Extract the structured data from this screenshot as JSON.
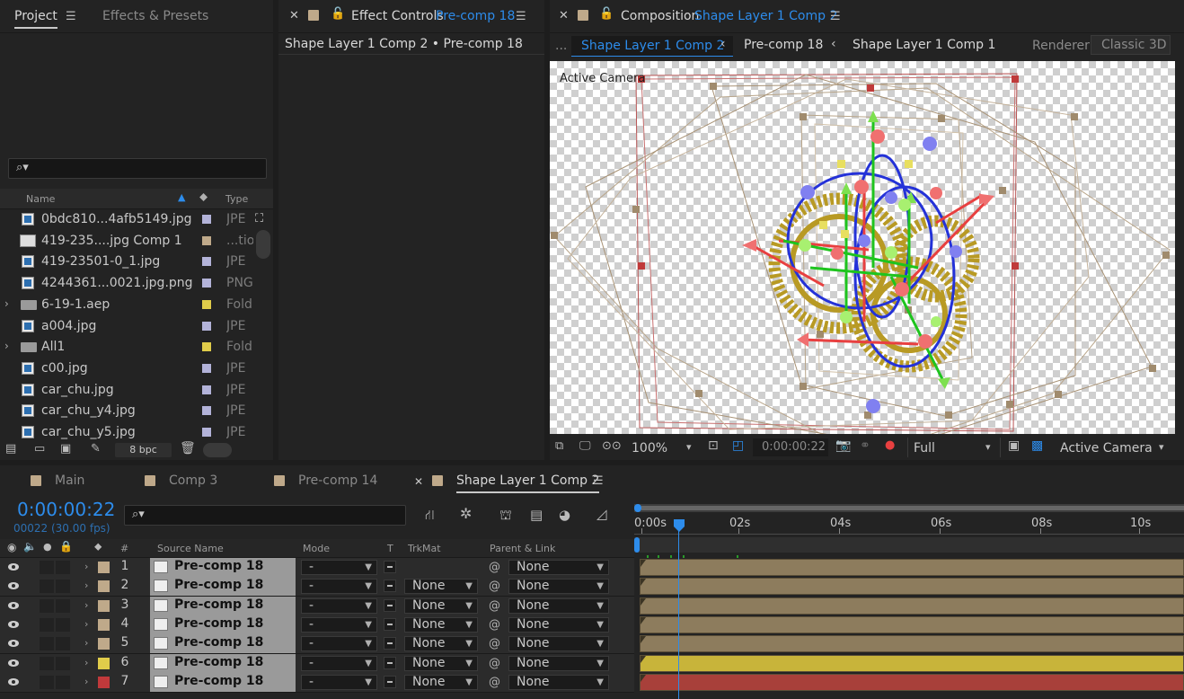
{
  "project_panel": {
    "tabs": [
      "Project",
      "Effects & Presets"
    ],
    "search_placeholder": "",
    "col_name": "Name",
    "col_type": "Type",
    "items": [
      {
        "name": "0bdc810...4afb5149.jpg",
        "type": "JPE",
        "label_color": "#b3b3d9",
        "icon": "image-file-icon",
        "expand": false
      },
      {
        "name": "419-235....jpg Comp 1",
        "type": "...tion",
        "label_color": "#bfa98a",
        "icon": "composition-icon",
        "expand": false
      },
      {
        "name": "419-23501-0_1.jpg",
        "type": "JPE",
        "label_color": "#b3b3d9",
        "icon": "image-file-icon",
        "expand": false
      },
      {
        "name": "4244361...0021.jpg.png",
        "type": "PNG",
        "label_color": "#b3b3d9",
        "icon": "image-file-icon",
        "expand": false
      },
      {
        "name": "6-19-1.aep",
        "type": "Fold",
        "label_color": "#e0cc4a",
        "icon": "folder-icon",
        "expand": true
      },
      {
        "name": "a004.jpg",
        "type": "JPE",
        "label_color": "#b3b3d9",
        "icon": "image-file-icon",
        "expand": false
      },
      {
        "name": "All1",
        "type": "Fold",
        "label_color": "#e0cc4a",
        "icon": "folder-icon",
        "expand": true
      },
      {
        "name": "c00.jpg",
        "type": "JPE",
        "label_color": "#b3b3d9",
        "icon": "image-file-icon",
        "expand": false
      },
      {
        "name": "car_chu.jpg",
        "type": "JPE",
        "label_color": "#b3b3d9",
        "icon": "image-file-icon",
        "expand": false
      },
      {
        "name": "car_chu_y4.jpg",
        "type": "JPE",
        "label_color": "#b3b3d9",
        "icon": "image-file-icon",
        "expand": false
      },
      {
        "name": "car_chu_y5.jpg",
        "type": "JPE",
        "label_color": "#b3b3d9",
        "icon": "image-file-icon",
        "expand": false
      }
    ],
    "bpc": "8 bpc"
  },
  "effect_controls": {
    "tab_label": "Effect Controls",
    "tab_target": "Pre-comp 18",
    "breadcrumb": "Shape Layer 1 Comp 2 • Pre-comp 18"
  },
  "composition": {
    "tab_label": "Composition",
    "tab_target": "Shape Layer 1 Comp 2",
    "nav_more": "...",
    "flow": [
      "Shape Layer 1 Comp 2",
      "Pre-comp 18",
      "Shape Layer 1 Comp 1"
    ],
    "renderer_label": "Renderer:",
    "renderer_value": "Classic 3D",
    "viewport_label": "Active Camera",
    "zoom": "100%",
    "timecode": "0:00:00:22",
    "resolution": "Full",
    "view": "Active Camera"
  },
  "timeline": {
    "tabs": [
      {
        "label": "Main",
        "color": "#bfa98a",
        "active": false
      },
      {
        "label": "Comp 3",
        "color": "#bfa98a",
        "active": false
      },
      {
        "label": "Pre-comp 14",
        "color": "#bfa98a",
        "active": false
      },
      {
        "label": "Shape Layer 1 Comp 2",
        "color": "#bfa98a",
        "active": true
      }
    ],
    "current_time": "0:00:00:22",
    "frame_info": "00022 (30.00 fps)",
    "search_placeholder": "",
    "columns": {
      "num": "#",
      "source": "Source Name",
      "mode": "Mode",
      "t": "T",
      "trkmat": "TrkMat",
      "parent": "Parent & Link"
    },
    "ruler": [
      "0:00s",
      "02s",
      "04s",
      "06s",
      "08s",
      "10s"
    ],
    "layers": [
      {
        "num": "1",
        "name": "Pre-comp 18",
        "mode": "-",
        "trkmat": "",
        "parent": "None",
        "color": "#bfa98a",
        "bar": "#8d7c5d"
      },
      {
        "num": "2",
        "name": "Pre-comp 18",
        "mode": "-",
        "trkmat": "None",
        "parent": "None",
        "color": "#bfa98a",
        "bar": "#8d7c5d"
      },
      {
        "num": "3",
        "name": "Pre-comp 18",
        "mode": "-",
        "trkmat": "None",
        "parent": "None",
        "color": "#bfa98a",
        "bar": "#8d7c5d"
      },
      {
        "num": "4",
        "name": "Pre-comp 18",
        "mode": "-",
        "trkmat": "None",
        "parent": "None",
        "color": "#bfa98a",
        "bar": "#8d7c5d"
      },
      {
        "num": "5",
        "name": "Pre-comp 18",
        "mode": "-",
        "trkmat": "None",
        "parent": "None",
        "color": "#bfa98a",
        "bar": "#8d7c5d"
      },
      {
        "num": "6",
        "name": "Pre-comp 18",
        "mode": "-",
        "trkmat": "None",
        "parent": "None",
        "color": "#e0cc4a",
        "bar": "#c8b43a"
      },
      {
        "num": "7",
        "name": "Pre-comp 18",
        "mode": "-",
        "trkmat": "None",
        "parent": "None",
        "color": "#c0393b",
        "bar": "#a8403a"
      }
    ]
  }
}
